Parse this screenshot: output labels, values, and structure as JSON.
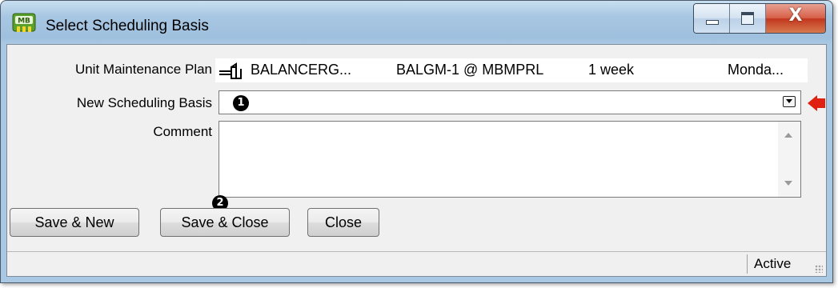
{
  "window": {
    "title": "Select Scheduling Basis",
    "app_icon": "mb-app-icon",
    "controls": {
      "minimize_icon": "minimize-icon",
      "maximize_icon": "maximize-icon",
      "close_glyph": "X"
    }
  },
  "form": {
    "plan_label": "Unit Maintenance Plan",
    "plan_row": {
      "icon": "plan-icon",
      "code": "BALANCERG...",
      "location": "BALGM-1 @ MBMPRL",
      "interval": "1 week",
      "day": "Monda..."
    },
    "basis_label": "New Scheduling Basis",
    "basis_value": "",
    "comment_label": "Comment",
    "comment_value": ""
  },
  "annotations": {
    "badge1": "1",
    "badge2": "2",
    "arrow_icon": "red-left-arrow-icon",
    "arrow_color": "#e02010"
  },
  "buttons": {
    "save_new": "Save & New",
    "save_close": "Save & Close",
    "close": "Close"
  },
  "status": {
    "text": "Active"
  }
}
